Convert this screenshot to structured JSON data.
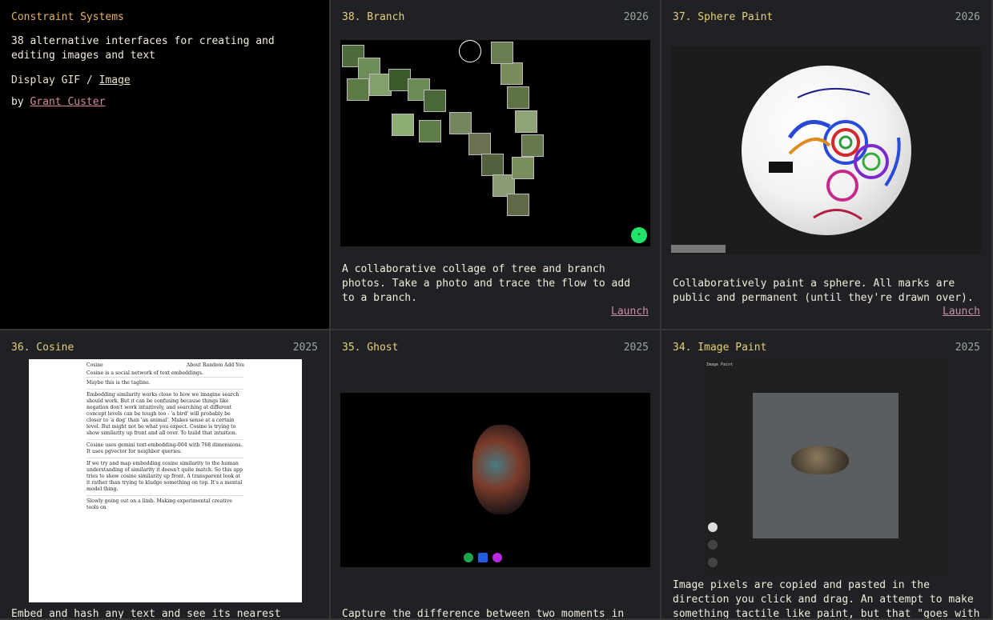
{
  "intro": {
    "site_title": "Constraint Systems",
    "tagline": "38 alternative interfaces for creating and editing images and text",
    "display_label": "Display",
    "display_gif": "GIF",
    "display_sep": "/",
    "display_image": "Image",
    "by": "by",
    "author": "Grant Custer"
  },
  "cards": [
    {
      "title": "38. Branch",
      "year": "2026",
      "desc": "A collaborative collage of tree and branch photos. Take a photo and trace the flow to add to a branch.",
      "launch": "Launch"
    },
    {
      "title": "37. Sphere Paint",
      "year": "2026",
      "desc": "Collaboratively paint a sphere. All marks are public and permanent (until they're drawn over).",
      "launch": "Launch"
    },
    {
      "title": "36. Cosine",
      "year": "2025",
      "desc": "Embed and hash any text and see its nearest"
    },
    {
      "title": "35. Ghost",
      "year": "2025",
      "desc": "Capture the difference between two moments in"
    },
    {
      "title": "34. Image Paint",
      "year": "2025",
      "desc": "Image pixels are copied and pasted in the direction you click and drag. An attempt to make something tactile like paint, but that \"goes with"
    }
  ],
  "cosine_preview": {
    "app_name": "Cosine",
    "nav": [
      "About",
      "Random",
      "Add",
      "You"
    ],
    "intro": "Cosine is a social network of text embeddings.",
    "posts": [
      "Maybe this is the tagline.",
      "Embedding similarity works close to how we imagine search should work. But it can be confusing because things like negation don't work intuitively, and searching at different concept levels can be tough too - 'a bird' will probably be closer to 'a dog' than 'an animal'. Makes sense at a certain level. But might not be what you expect. Cosine is trying to show similarity up front and all over. To build that intuition.",
      "Cosine uses gemini text-embedding-004 with 768 dimensions. It uses pgvector for neighbor queries.",
      "If we try and map embedding cosine similarity to the human understanding of similarity it doesn't quite match. So this app tries to show cosine similarity up front. A transparent look at it rather than trying to kludge something on top. It's a mental model thing.",
      "Slowly going out on a limb. Making experimental creative tools on"
    ]
  },
  "image_paint_preview": {
    "label": "Image Paint"
  },
  "colors": {
    "accent_title": "#e6d07a",
    "link": "#c98fa8",
    "site_title": "#e6b25a"
  }
}
